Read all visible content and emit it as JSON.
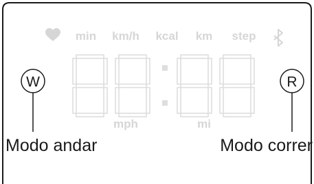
{
  "indicators": {
    "min": "min",
    "kmh": "km/h",
    "kcal": "kcal",
    "km": "km",
    "step": "step",
    "mph": "mph",
    "mi": "mi"
  },
  "display": {
    "digits": "88:88",
    "segment_color": "#dedede"
  },
  "buttons": {
    "walk_letter": "W",
    "run_letter": "R"
  },
  "callouts": {
    "walk_mode": "Modo andar",
    "run_mode": "Modo correr"
  },
  "colors": {
    "line": "#1a1a1a",
    "indicator": "#d6d6d6"
  }
}
